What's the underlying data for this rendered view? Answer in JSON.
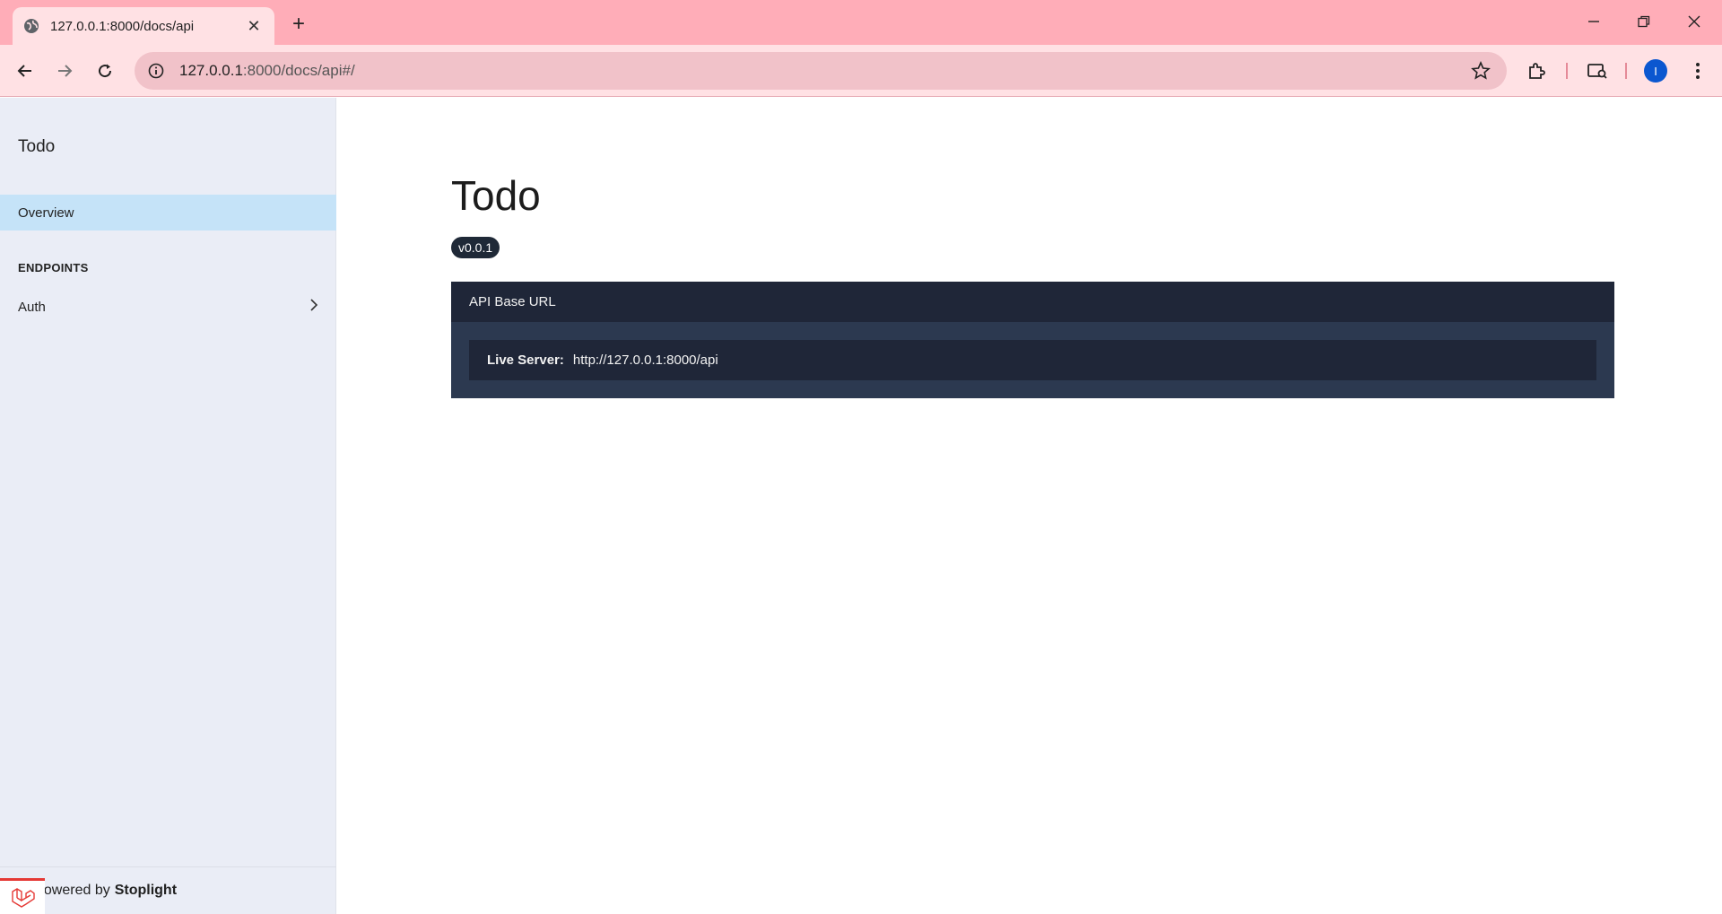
{
  "browser": {
    "tab_title": "127.0.0.1:8000/docs/api",
    "url_host": "127.0.0.1",
    "url_path": ":8000/docs/api#/",
    "avatar_letter": "I",
    "accent_color": "#ffadb8"
  },
  "sidebar": {
    "title": "Todo",
    "overview_label": "Overview",
    "section_label": "ENDPOINTS",
    "items": [
      {
        "label": "Auth"
      }
    ],
    "footer_prefix": "powered by",
    "footer_brand": "Stoplight"
  },
  "main": {
    "title": "Todo",
    "version": "v0.0.1",
    "panel_title": "API Base URL",
    "server_label": "Live Server:",
    "server_url": "http://127.0.0.1:8000/api"
  }
}
